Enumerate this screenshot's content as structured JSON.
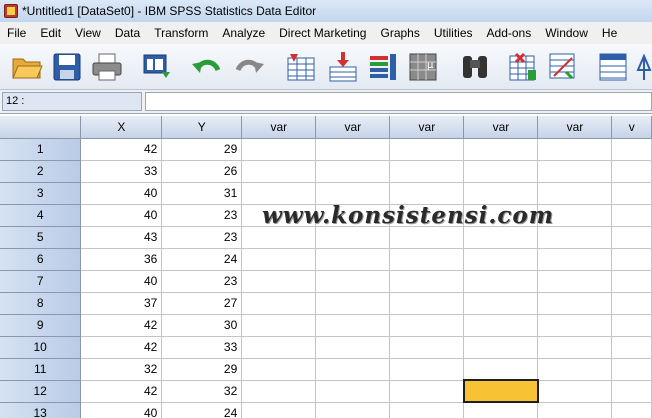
{
  "window": {
    "title": "*Untitled1 [DataSet0] - IBM SPSS Statistics Data Editor"
  },
  "menu": [
    {
      "label": "File"
    },
    {
      "label": "Edit"
    },
    {
      "label": "View"
    },
    {
      "label": "Data"
    },
    {
      "label": "Transform"
    },
    {
      "label": "Analyze"
    },
    {
      "label": "Direct Marketing"
    },
    {
      "label": "Graphs"
    },
    {
      "label": "Utilities"
    },
    {
      "label": "Add-ons"
    },
    {
      "label": "Window"
    },
    {
      "label": "He"
    }
  ],
  "toolbar": {
    "icons": [
      "open-folder-icon",
      "save-icon",
      "print-icon",
      "recall-dialog-icon",
      "undo-icon",
      "redo-icon",
      "go-to-case-icon",
      "insert-cases-icon",
      "variables-icon",
      "descriptive-stats-icon",
      "find-icon",
      "insert-variable-icon",
      "split-file-icon",
      "weight-cases-icon",
      "value-labels-icon"
    ]
  },
  "cell_reference": {
    "label": "12 :",
    "value": ""
  },
  "grid": {
    "columns": [
      "X",
      "Y",
      "var",
      "var",
      "var",
      "var",
      "var",
      "v"
    ],
    "rows": [
      {
        "id": "1",
        "x": "42",
        "y": "29"
      },
      {
        "id": "2",
        "x": "33",
        "y": "26"
      },
      {
        "id": "3",
        "x": "40",
        "y": "31"
      },
      {
        "id": "4",
        "x": "40",
        "y": "23"
      },
      {
        "id": "5",
        "x": "43",
        "y": "23"
      },
      {
        "id": "6",
        "x": "36",
        "y": "24"
      },
      {
        "id": "7",
        "x": "40",
        "y": "23"
      },
      {
        "id": "8",
        "x": "37",
        "y": "27"
      },
      {
        "id": "9",
        "x": "42",
        "y": "30"
      },
      {
        "id": "10",
        "x": "42",
        "y": "33"
      },
      {
        "id": "11",
        "x": "32",
        "y": "29"
      },
      {
        "id": "12",
        "x": "42",
        "y": "32"
      },
      {
        "id": "13",
        "x": "40",
        "y": "24"
      }
    ],
    "selected_cell": {
      "row": "12",
      "column": "var"
    },
    "selected_color": "#f7c234"
  },
  "watermark": "www.konsistensi.com"
}
